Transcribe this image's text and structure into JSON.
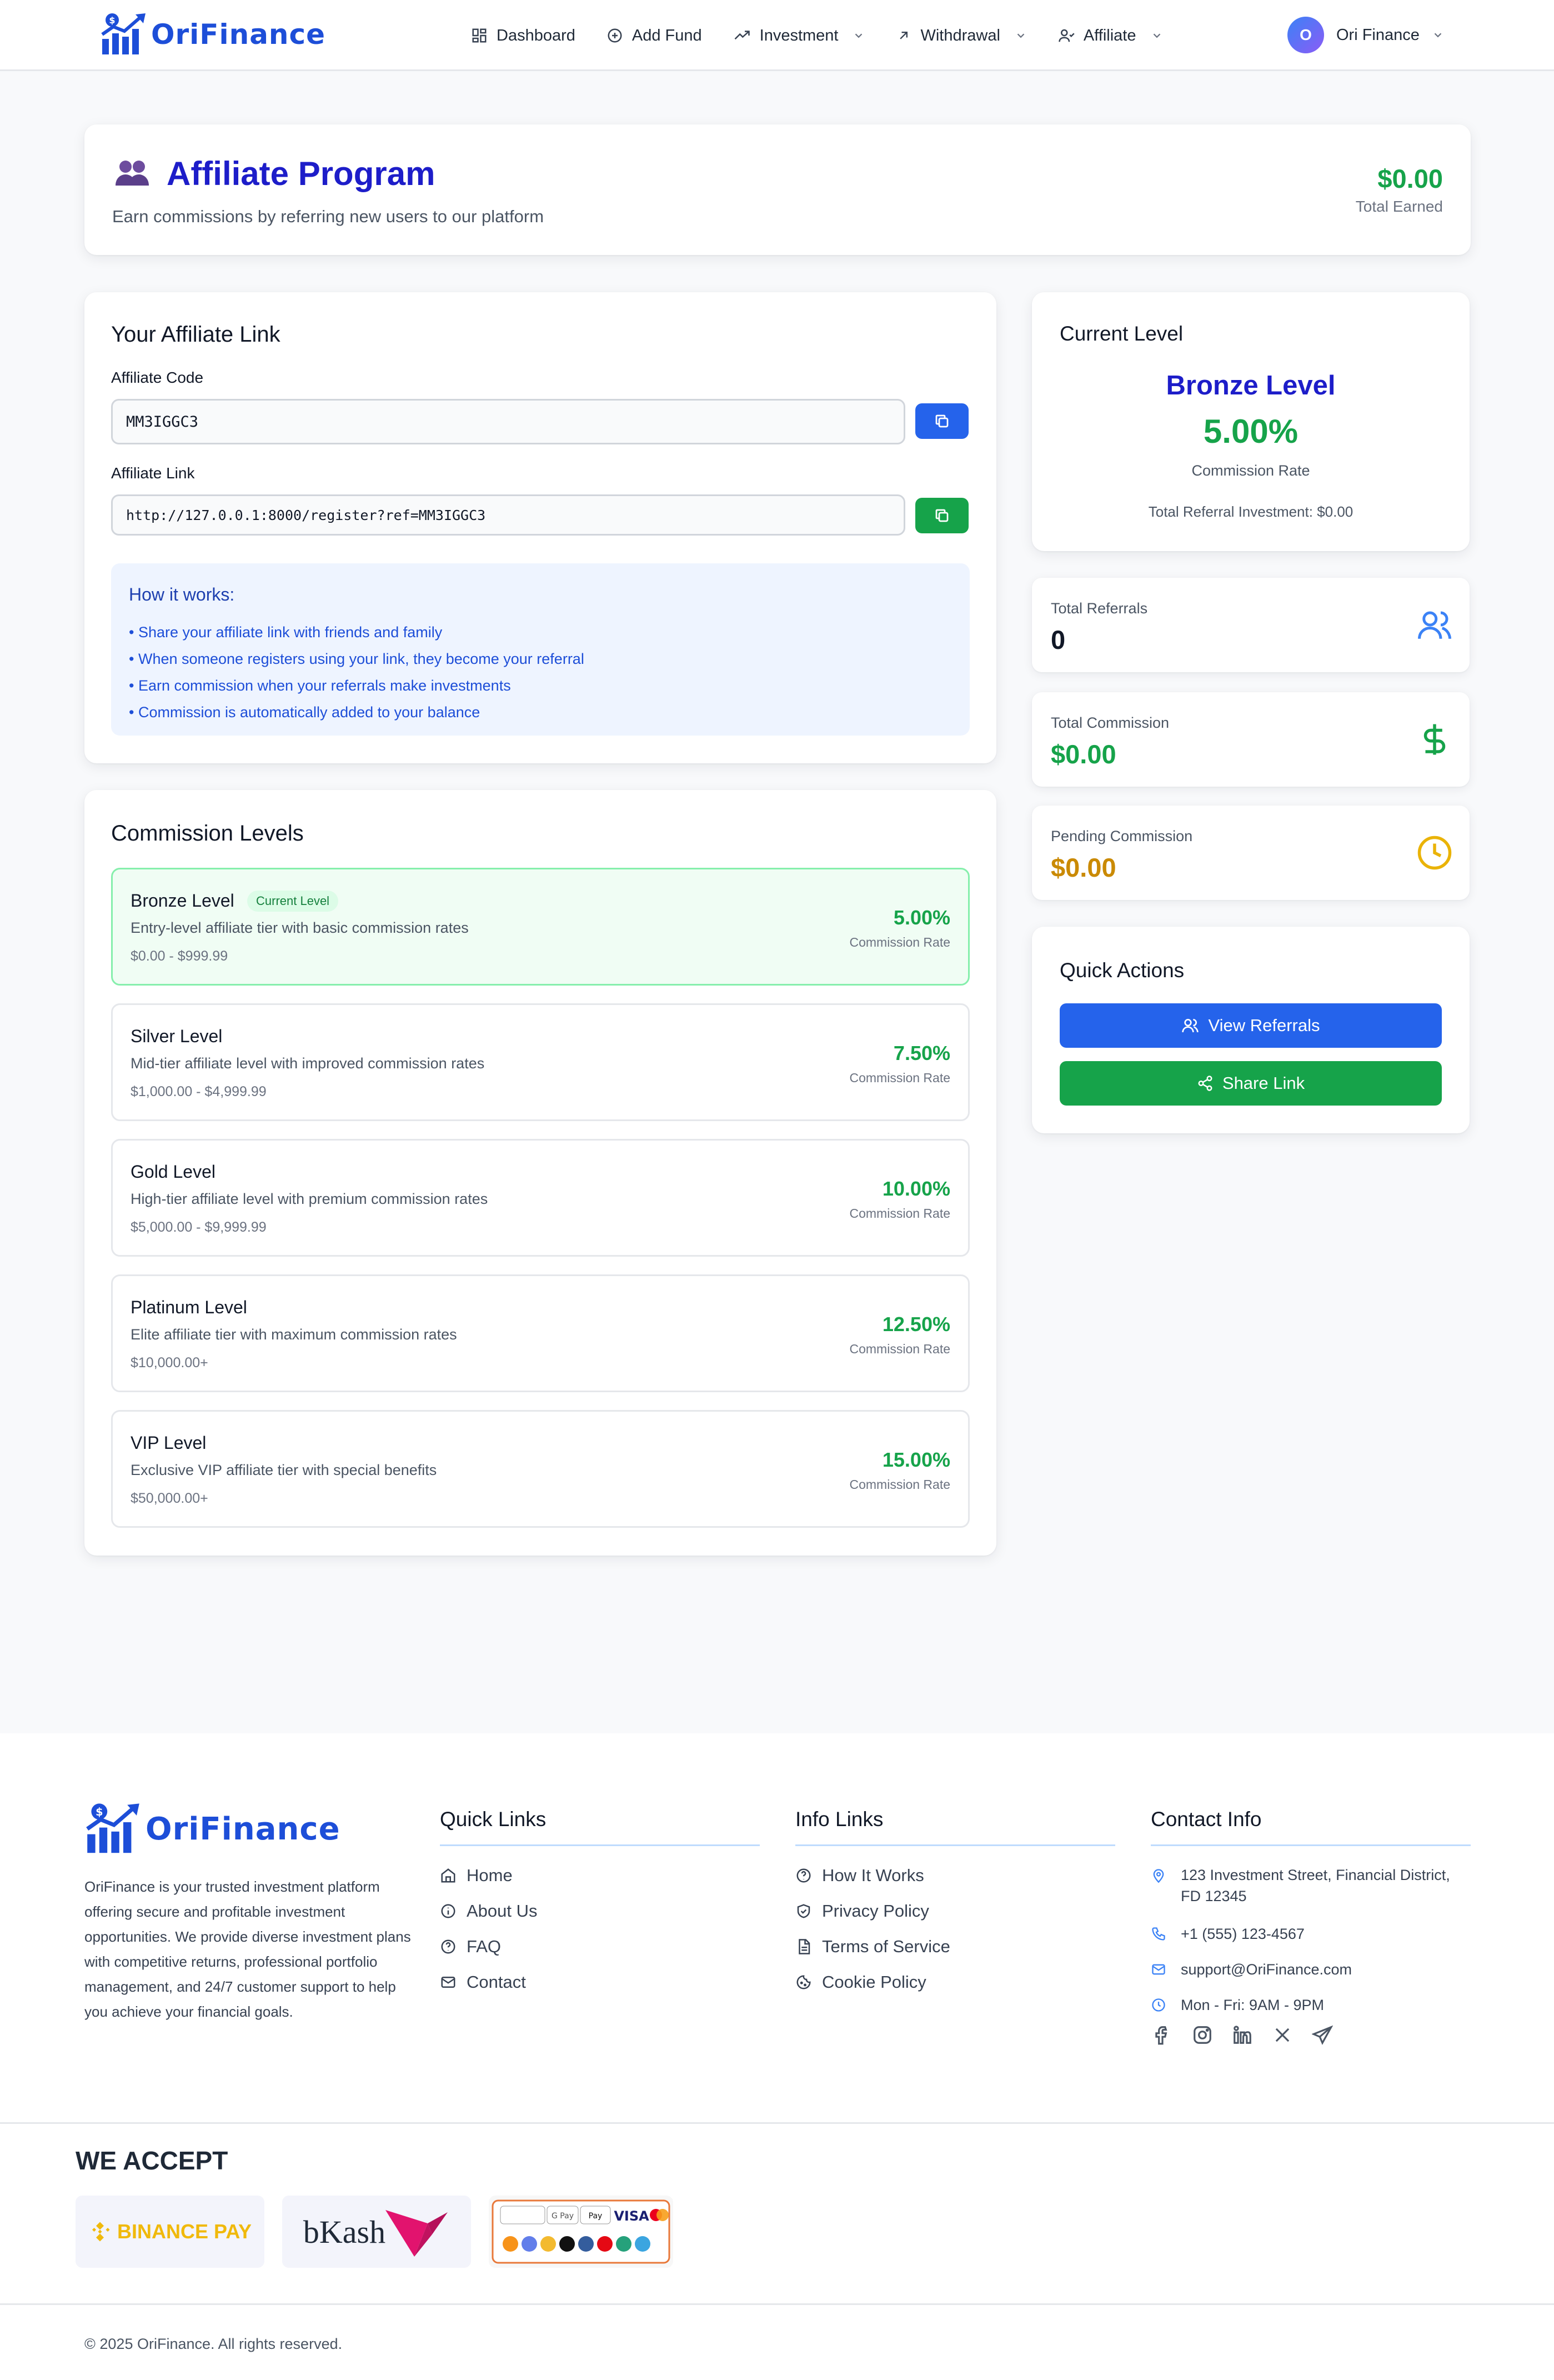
{
  "brand": {
    "name": "OriFinance",
    "logo_icon": "chart-growth-dollar-icon"
  },
  "nav": {
    "items": [
      {
        "label": "Dashboard",
        "icon": "grid-icon"
      },
      {
        "label": "Add Fund",
        "icon": "plus-circle-icon"
      },
      {
        "label": "Investment",
        "icon": "trend-up-icon"
      },
      {
        "label": "Withdrawal",
        "icon": "arrow-up-right-icon"
      },
      {
        "label": "Affiliate",
        "icon": "user-icon"
      }
    ],
    "user": {
      "initial": "O",
      "name": "Ori Finance"
    }
  },
  "hero": {
    "title": "Affiliate Program",
    "subtitle": "Earn commissions by referring new users to our platform",
    "total_earned": "$0.00",
    "total_earned_label": "Total Earned"
  },
  "affiliate_link": {
    "title": "Your Affiliate Link",
    "code_label": "Affiliate Code",
    "code": "MM3IGGC3",
    "link_label": "Affiliate Link",
    "link": "http://127.0.0.1:8000/register?ref=MM3IGGC3",
    "how_title": "How it works:",
    "how_items": [
      "• Share your affiliate link with friends and family",
      "• When someone registers using your link, they become your referral",
      "• Earn commission when your referrals make investments",
      "• Commission is automatically added to your balance"
    ]
  },
  "levels": {
    "title": "Commission Levels",
    "current_badge": "Current Level",
    "rate_label": "Commission Rate",
    "items": [
      {
        "name": "Bronze Level",
        "desc": "Entry-level affiliate tier with basic commission rates",
        "range": "$0.00 - $999.99",
        "rate": "5.00%"
      },
      {
        "name": "Silver Level",
        "desc": "Mid-tier affiliate level with improved commission rates",
        "range": "$1,000.00 - $4,999.99",
        "rate": "7.50%"
      },
      {
        "name": "Gold Level",
        "desc": "High-tier affiliate level with premium commission rates",
        "range": "$5,000.00 - $9,999.99",
        "rate": "10.00%"
      },
      {
        "name": "Platinum Level",
        "desc": "Elite affiliate tier with maximum commission rates",
        "range": "$10,000.00+",
        "rate": "12.50%"
      },
      {
        "name": "VIP Level",
        "desc": "Exclusive VIP affiliate tier with special benefits",
        "range": "$50,000.00+",
        "rate": "15.00%"
      }
    ]
  },
  "current_level": {
    "title": "Current Level",
    "level": "Bronze Level",
    "rate": "5.00%",
    "rate_label": "Commission Rate",
    "investment": "Total Referral Investment: $0.00"
  },
  "stats": [
    {
      "label": "Total Referrals",
      "value": "0",
      "icon": "users-icon",
      "color": "#111827",
      "icon_color": "#3b82f6"
    },
    {
      "label": "Total Commission",
      "value": "$0.00",
      "icon": "dollar-icon",
      "color": "#16a34a",
      "icon_color": "#16a34a"
    },
    {
      "label": "Pending Commission",
      "value": "$0.00",
      "icon": "clock-icon",
      "color": "#ca8a04",
      "icon_color": "#eab308"
    }
  ],
  "quick_actions": {
    "title": "Quick Actions",
    "view_referrals": "View Referrals",
    "share_link": "Share Link"
  },
  "footer": {
    "about": "OriFinance is your trusted investment platform offering secure and profitable investment opportunities. We provide diverse investment plans with competitive returns, professional portfolio management, and 24/7 customer support to help you achieve your financial goals.",
    "quick_links_title": "Quick Links",
    "quick_links": [
      {
        "label": "Home",
        "icon": "home-icon"
      },
      {
        "label": "About Us",
        "icon": "info-icon"
      },
      {
        "label": "FAQ",
        "icon": "question-icon"
      },
      {
        "label": "Contact",
        "icon": "mail-icon"
      }
    ],
    "info_links_title": "Info Links",
    "info_links": [
      {
        "label": "How It Works",
        "icon": "question-icon"
      },
      {
        "label": "Privacy Policy",
        "icon": "shield-check-icon"
      },
      {
        "label": "Terms of Service",
        "icon": "document-icon"
      },
      {
        "label": "Cookie Policy",
        "icon": "cookie-icon"
      }
    ],
    "contact_title": "Contact Info",
    "address": "123 Investment Street, Financial District, FD 12345",
    "phone": "+1 (555) 123-4567",
    "email": "support@OriFinance.com",
    "hours": "Mon - Fri: 9AM - 9PM",
    "social": [
      "facebook-icon",
      "instagram-icon",
      "linkedin-icon",
      "x-icon",
      "telegram-icon"
    ],
    "accept_title": "WE ACCEPT",
    "payments": [
      {
        "name": "BINANCE PAY",
        "icon": "binance-pay-logo"
      },
      {
        "name": "bKash",
        "icon": "bkash-logo"
      },
      {
        "name": "payment-methods",
        "icon": "cards-crypto-logo"
      }
    ],
    "copyright": "© 2025 OriFinance. All rights reserved."
  },
  "colors": {
    "brand": "#1d4ed8",
    "green": "#16a34a",
    "blue_btn": "#2563eb",
    "amber": "#ca8a04"
  }
}
